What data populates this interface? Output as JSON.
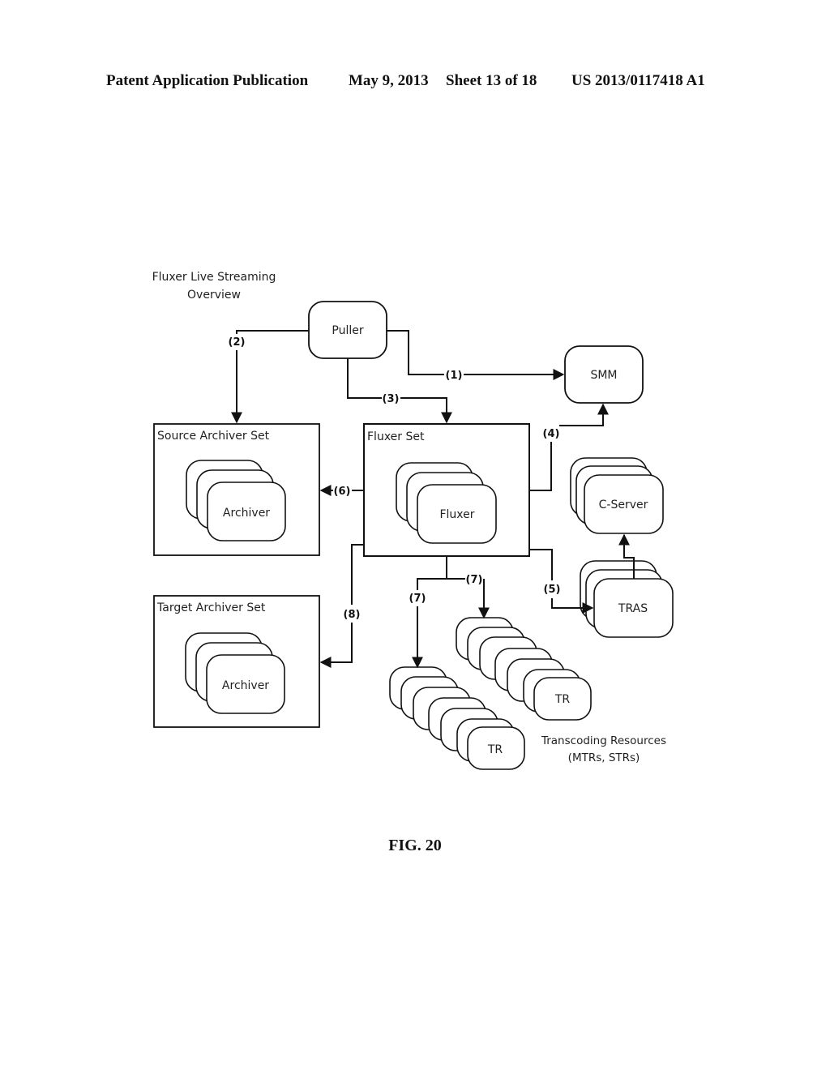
{
  "header": {
    "publication": "Patent Application Publication",
    "date": "May 9, 2013",
    "sheet": "Sheet 13 of 18",
    "number": "US 2013/0117418 A1"
  },
  "diagram": {
    "title_line1": "Fluxer Live Streaming",
    "title_line2": "Overview",
    "nodes": {
      "puller": "Puller",
      "smm": "SMM",
      "source_archiver_set": "Source Archiver Set",
      "source_archiver": "Archiver",
      "fluxer_set": "Fluxer Set",
      "fluxer": "Fluxer",
      "c_server": "C-Server",
      "tras": "TRAS",
      "target_archiver_set": "Target Archiver Set",
      "target_archiver": "Archiver",
      "tr_left": "TR",
      "tr_right": "TR"
    },
    "edges": {
      "e1": "(1)",
      "e2": "(2)",
      "e3": "(3)",
      "e4": "(4)",
      "e5": "(5)",
      "e6": "(6)",
      "e7a": "(7)",
      "e7b": "(7)",
      "e8": "(8)"
    },
    "transcoding_caption_line1": "Transcoding Resources",
    "transcoding_caption_line2": "(MTRs, STRs)"
  },
  "figure_label": "FIG. 20"
}
